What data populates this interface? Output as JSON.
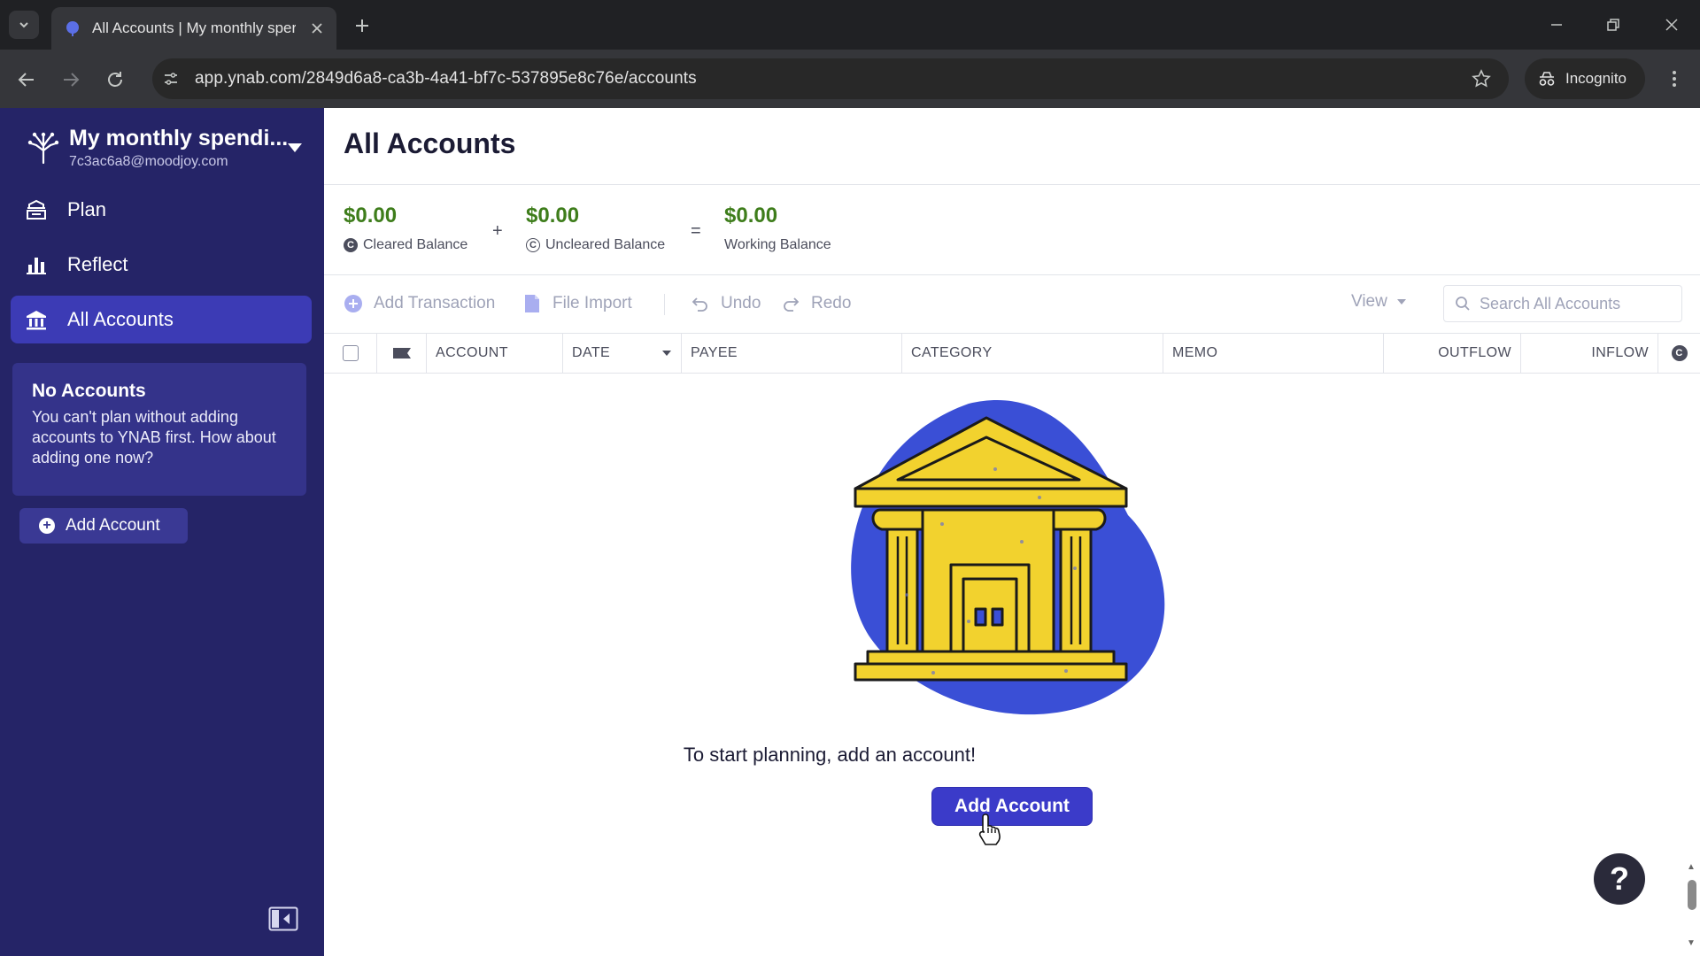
{
  "browser": {
    "tab_title": "All Accounts | My monthly sper",
    "url": "app.ynab.com/2849d6a8-ca3b-4a41-bf7c-537895e8c76e/accounts",
    "incognito_label": "Incognito"
  },
  "sidebar": {
    "budget_name": "My monthly spendi...",
    "email": "7c3ac6a8@moodjoy.com",
    "nav": [
      {
        "label": "Plan",
        "icon": "plan-icon"
      },
      {
        "label": "Reflect",
        "icon": "reflect-icon"
      },
      {
        "label": "All Accounts",
        "icon": "bank-icon",
        "active": true
      }
    ],
    "no_accounts": {
      "title": "No Accounts",
      "text": "You can't plan without adding accounts to YNAB first. How about adding one now?"
    },
    "add_account_label": "Add Account"
  },
  "main": {
    "title": "All Accounts",
    "balances": {
      "cleared": {
        "amount": "$0.00",
        "label": "Cleared Balance"
      },
      "uncleared": {
        "amount": "$0.00",
        "label": "Uncleared Balance"
      },
      "working": {
        "amount": "$0.00",
        "label": "Working Balance"
      },
      "plus": "+",
      "equals": "="
    },
    "actions": {
      "add_transaction": "Add Transaction",
      "file_import": "File Import",
      "undo": "Undo",
      "redo": "Redo",
      "view": "View",
      "search_placeholder": "Search All Accounts"
    },
    "columns": {
      "account": "ACCOUNT",
      "date": "DATE",
      "payee": "PAYEE",
      "category": "CATEGORY",
      "memo": "MEMO",
      "outflow": "OUTFLOW",
      "inflow": "INFLOW"
    },
    "empty": {
      "message": "To start planning, add an account!",
      "button": "Add Account"
    },
    "help_label": "?"
  },
  "colors": {
    "sidebar_bg": "#252467",
    "sidebar_active": "#3c3bb5",
    "primary_button": "#3b3bc9",
    "balance_green": "#3e7d1b",
    "illustration_blue": "#3a4fd6",
    "illustration_yellow": "#f2d22e"
  }
}
